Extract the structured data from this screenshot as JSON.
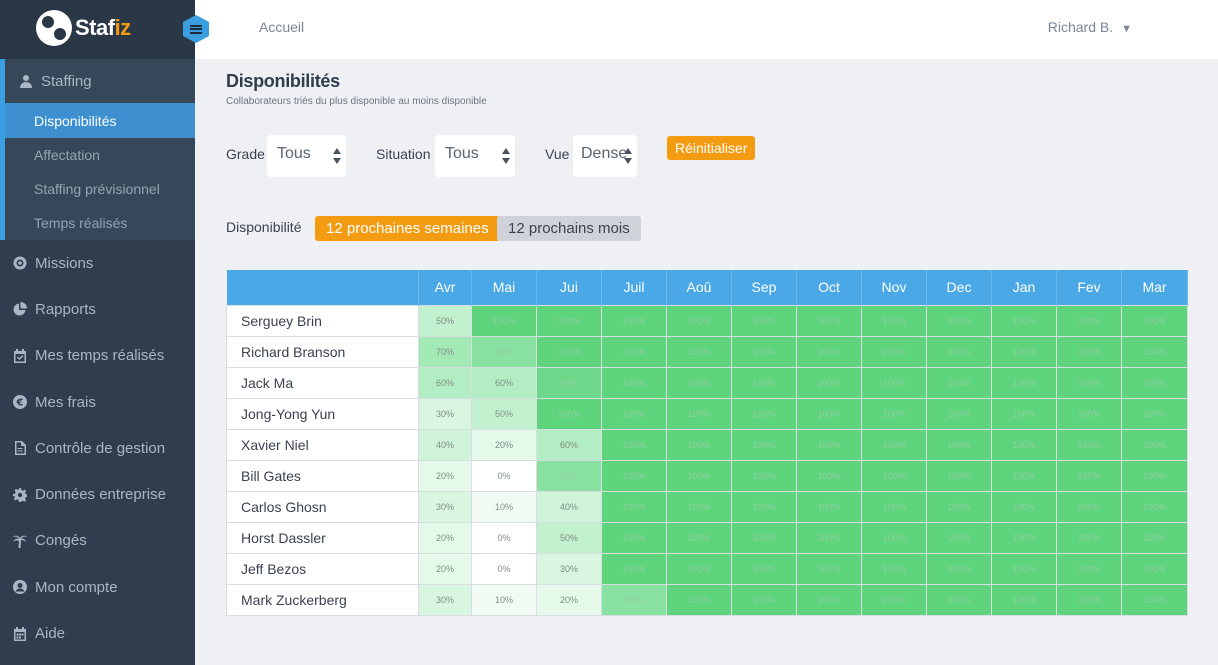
{
  "app": {
    "logo_text": "Staf",
    "logo_accent": "iz",
    "breadcrumb": "Accueil",
    "user_name": "Richard B.",
    "user_caret": "▼"
  },
  "sidebar": {
    "section": {
      "label": "Staffing",
      "icon": "user-icon",
      "items": [
        {
          "label": "Disponibilités",
          "active": true
        },
        {
          "label": "Affectation"
        },
        {
          "label": "Staffing prévisionnel"
        },
        {
          "label": "Temps réalisés"
        }
      ]
    },
    "items": [
      {
        "label": "Missions",
        "icon": "target-icon"
      },
      {
        "label": "Rapports",
        "icon": "pie-chart-icon"
      },
      {
        "label": "Mes temps réalisés",
        "icon": "calendar-check-icon"
      },
      {
        "label": "Mes frais",
        "icon": "euro-icon"
      },
      {
        "label": "Contrôle de gestion",
        "icon": "document-icon"
      },
      {
        "label": "Données entreprise",
        "icon": "gear-icon"
      },
      {
        "label": "Congés",
        "icon": "palm-tree-icon"
      },
      {
        "label": "Mon compte",
        "icon": "account-icon"
      },
      {
        "label": "Aide",
        "icon": "calendar-icon"
      }
    ]
  },
  "page": {
    "title": "Disponibilités",
    "subtitle": "Collaborateurs triés du plus disponible au moins disponible"
  },
  "filters": {
    "grade_label": "Grade",
    "grade_value": "Tous",
    "situation_label": "Situation",
    "situation_value": "Tous",
    "vue_label": "Vue",
    "vue_value": "Dense",
    "reset_label": "Réinitialiser"
  },
  "availability": {
    "label": "Disponibilité",
    "active_option": "12 prochaines semaines",
    "other_option": "12 prochains mois"
  },
  "table": {
    "months": [
      "Avr",
      "Mai",
      "Jui",
      "Juil",
      "Aoû",
      "Sep",
      "Oct",
      "Nov",
      "Dec",
      "Jan",
      "Fev",
      "Mar"
    ],
    "rows": [
      {
        "name": "Serguey Brin",
        "values": [
          "50%",
          "100%",
          "100%",
          "100%",
          "100%",
          "100%",
          "100%",
          "100%",
          "100%",
          "100%",
          "100%",
          "100%"
        ]
      },
      {
        "name": "Richard Branson",
        "values": [
          "70%",
          "80%",
          "100%",
          "100%",
          "100%",
          "100%",
          "100%",
          "100%",
          "100%",
          "100%",
          "100%",
          "100%"
        ]
      },
      {
        "name": "Jack Ma",
        "values": [
          "60%",
          "60%",
          "90%",
          "100%",
          "100%",
          "100%",
          "100%",
          "100%",
          "100%",
          "100%",
          "100%",
          "100%"
        ]
      },
      {
        "name": "Jong-Yong Yun",
        "values": [
          "30%",
          "50%",
          "100%",
          "100%",
          "100%",
          "100%",
          "100%",
          "100%",
          "100%",
          "100%",
          "100%",
          "100%"
        ]
      },
      {
        "name": "Xavier Niel",
        "values": [
          "40%",
          "20%",
          "60%",
          "100%",
          "100%",
          "100%",
          "100%",
          "100%",
          "100%",
          "100%",
          "100%",
          "100%"
        ]
      },
      {
        "name": "Bill Gates",
        "values": [
          "20%",
          "0%",
          "80%",
          "100%",
          "100%",
          "100%",
          "100%",
          "100%",
          "100%",
          "100%",
          "100%",
          "100%"
        ]
      },
      {
        "name": "Carlos Ghosn",
        "values": [
          "30%",
          "10%",
          "40%",
          "100%",
          "100%",
          "100%",
          "100%",
          "100%",
          "100%",
          "100%",
          "100%",
          "100%"
        ]
      },
      {
        "name": "Horst Dassler",
        "values": [
          "20%",
          "0%",
          "50%",
          "100%",
          "100%",
          "100%",
          "100%",
          "100%",
          "100%",
          "100%",
          "100%",
          "100%"
        ]
      },
      {
        "name": "Jeff Bezos",
        "values": [
          "20%",
          "0%",
          "30%",
          "100%",
          "100%",
          "100%",
          "100%",
          "100%",
          "100%",
          "100%",
          "100%",
          "100%"
        ]
      },
      {
        "name": "Mark Zuckerberg",
        "values": [
          "30%",
          "10%",
          "20%",
          "80%",
          "100%",
          "100%",
          "100%",
          "100%",
          "100%",
          "100%",
          "100%",
          "100%"
        ]
      }
    ]
  },
  "colors": {
    "accent_orange": "#f39c12",
    "header_blue": "#4aa8e6",
    "sidebar_bg": "#2f3d4e",
    "availability_full": "#5ed47d"
  }
}
